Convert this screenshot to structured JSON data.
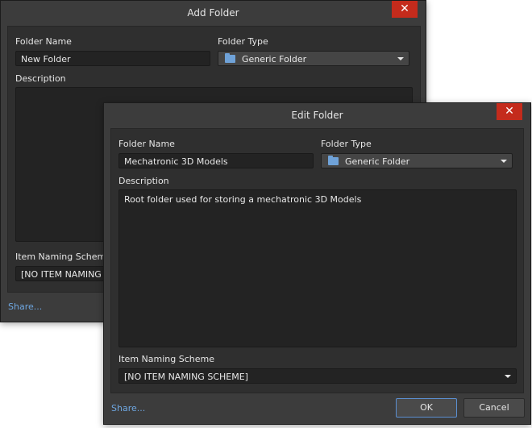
{
  "add_folder": {
    "title": "Add Folder",
    "close_glyph": "✕",
    "folder_name_label": "Folder Name",
    "folder_name_value": "New Folder",
    "folder_type_label": "Folder Type",
    "folder_type_value": "Generic Folder",
    "description_label": "Description",
    "description_value": "",
    "naming_scheme_label": "Item Naming Scheme",
    "naming_scheme_value": "[NO ITEM NAMING SCHEME]",
    "share_link": "Share..."
  },
  "edit_folder": {
    "title": "Edit Folder",
    "close_glyph": "✕",
    "folder_name_label": "Folder Name",
    "folder_name_value": "Mechatronic 3D Models",
    "folder_type_label": "Folder Type",
    "folder_type_value": "Generic Folder",
    "description_label": "Description",
    "description_value": "Root folder used for storing a mechatronic 3D Models",
    "naming_scheme_label": "Item Naming Scheme",
    "naming_scheme_value": "[NO ITEM NAMING SCHEME]",
    "share_link": "Share...",
    "ok_label": "OK",
    "cancel_label": "Cancel"
  },
  "colors": {
    "dialog_bg": "#3c3c3c",
    "close_red": "#c42b1c",
    "link_blue": "#6ea6e0",
    "folder_icon_blue": "#6fa2d8"
  },
  "icons": [
    "close-icon",
    "folder-icon",
    "chevron-down-icon"
  ]
}
